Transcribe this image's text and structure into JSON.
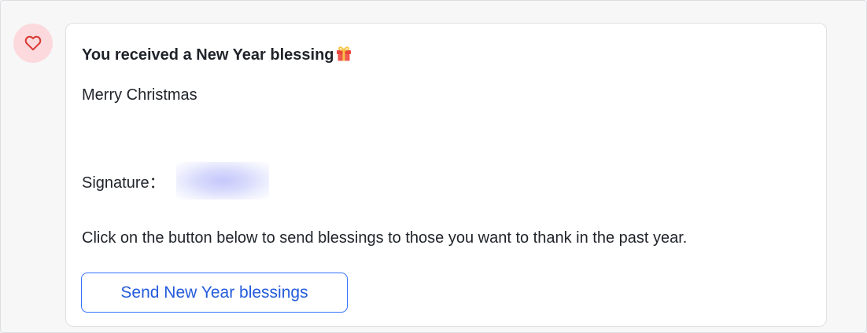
{
  "avatar": {
    "icon": "heart-icon",
    "icon_color": "#d83931",
    "background": "#fcd9dd"
  },
  "message": {
    "title": "You received a New Year blessing",
    "title_icon": "gift-icon",
    "body": "Merry Christmas",
    "signature_label": "Signature：",
    "instruction": "Click on the button below to send blessings to those you want to thank in the past year.",
    "button_label": "Send New Year blessings"
  },
  "colors": {
    "button_border": "#3370ff",
    "button_text": "#245bdb"
  }
}
